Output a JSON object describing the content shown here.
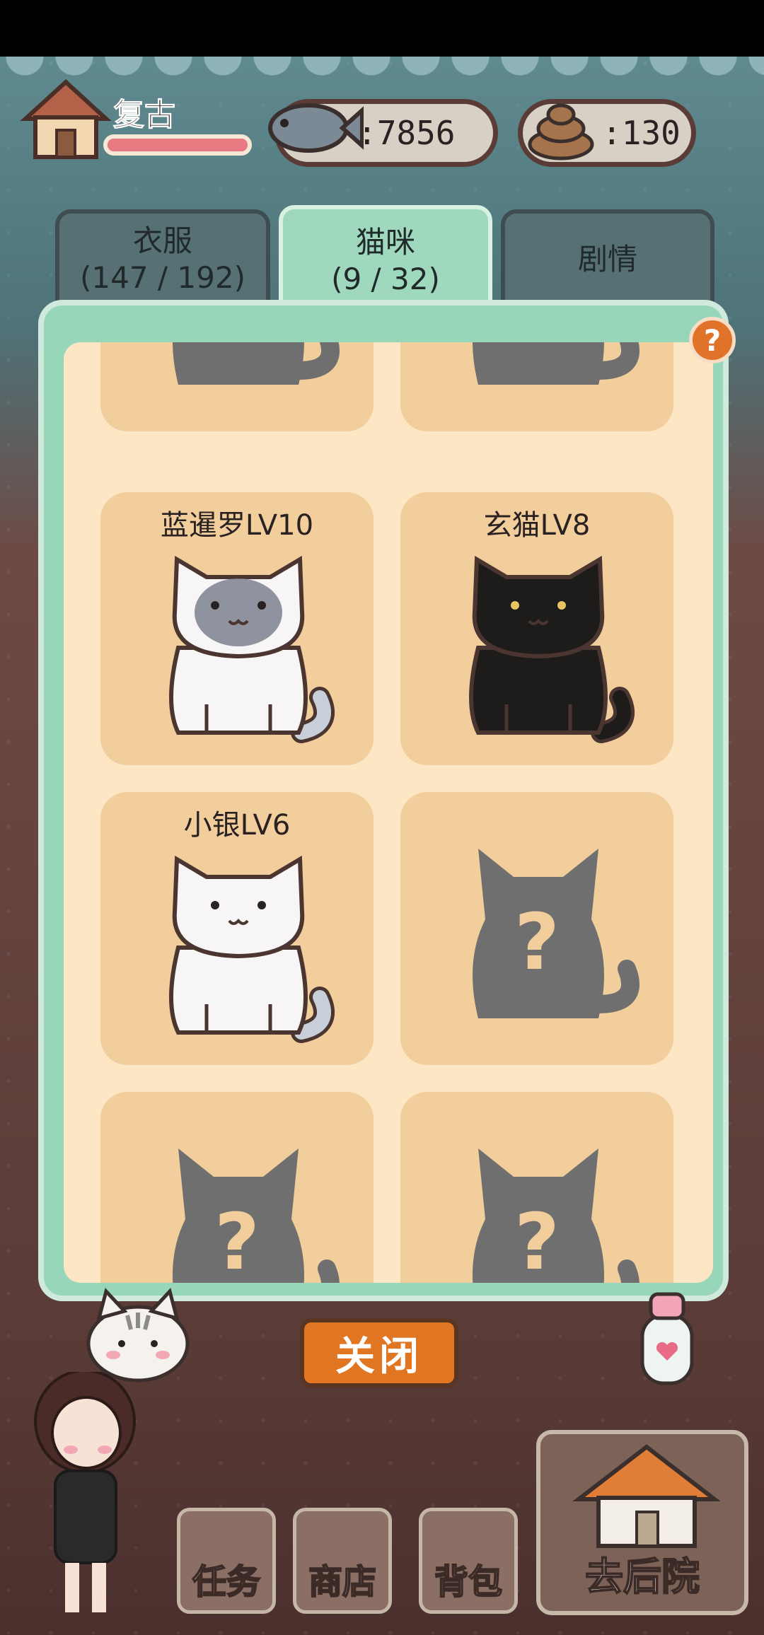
{
  "hud": {
    "player_name": "复古",
    "hp_fraction": 1.0,
    "fish_count": ":7856",
    "poop_count": ":130"
  },
  "tabs": [
    {
      "label": "衣服",
      "count": "(147 / 192)"
    },
    {
      "label": "猫咪",
      "count": "(9 / 32)"
    },
    {
      "label": "剧情",
      "count": ""
    }
  ],
  "help_label": "?",
  "cards": [
    {
      "name": "",
      "type": "locked"
    },
    {
      "name": "",
      "type": "locked"
    },
    {
      "name": "蓝暹罗LV10",
      "type": "siamese"
    },
    {
      "name": "玄猫LV8",
      "type": "black"
    },
    {
      "name": "小银LV6",
      "type": "white"
    },
    {
      "name": "",
      "type": "locked"
    },
    {
      "name": "",
      "type": "locked"
    },
    {
      "name": "",
      "type": "locked"
    }
  ],
  "close_label": "关闭",
  "nav": {
    "tasks": "任务",
    "shop": "商店",
    "bag": "背包",
    "backyard": "去后院"
  }
}
